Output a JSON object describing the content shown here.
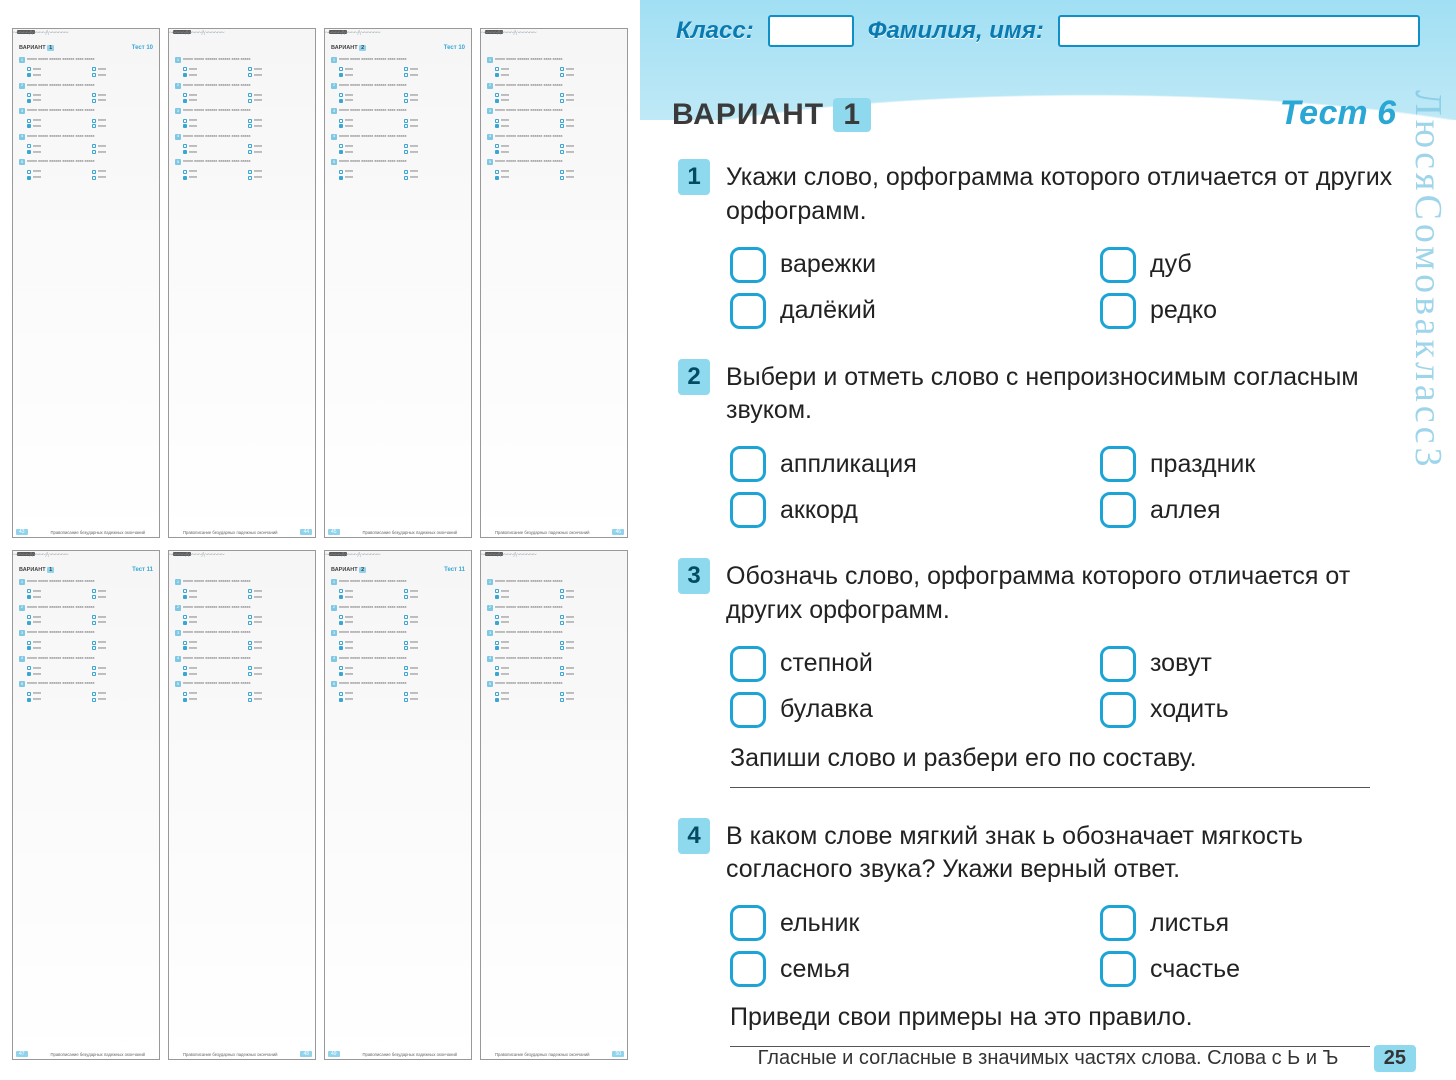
{
  "thumbs": [
    {
      "variant": "ВАРИАНТ 1",
      "test": "Тест 10",
      "page": "43",
      "side": "l"
    },
    {
      "variant": "",
      "test": "",
      "page": "44",
      "side": "r"
    },
    {
      "variant": "ВАРИАНТ 2",
      "test": "Тест 10",
      "page": "45",
      "side": "l"
    },
    {
      "variant": "",
      "test": "",
      "page": "46",
      "side": "r"
    },
    {
      "variant": "ВАРИАНТ 1",
      "test": "Тест 11",
      "page": "47",
      "side": "l"
    },
    {
      "variant": "",
      "test": "",
      "page": "48",
      "side": "r"
    },
    {
      "variant": "ВАРИАНТ 2",
      "test": "Тест 11",
      "page": "49",
      "side": "l"
    },
    {
      "variant": "",
      "test": "",
      "page": "50",
      "side": "r"
    }
  ],
  "thumb_footer": "Правописание безударных падежных окончаний",
  "header": {
    "class_label": "Класс:",
    "name_label": "Фамилия, имя:"
  },
  "title": {
    "variant": "ВАРИАНТ",
    "variant_num": "1",
    "test": "Тест 6"
  },
  "questions": [
    {
      "num": "1",
      "text": "Укажи слово, орфограмма которого отличается от других орфограмм.",
      "options": [
        "варежки",
        "дуб",
        "далёкий",
        "редко"
      ]
    },
    {
      "num": "2",
      "text": "Выбери и отметь слово с непроизносимым соглас­ным звуком.",
      "options": [
        "аппликация",
        "праздник",
        "аккорд",
        "аллея"
      ]
    },
    {
      "num": "3",
      "text": "Обозначь слово, орфограмма которого отличается от других орфограмм.",
      "options": [
        "степной",
        "зовут",
        "булавка",
        "ходить"
      ],
      "follow": "Запиши слово и разбери его по составу."
    },
    {
      "num": "4",
      "text": "В каком слове мягкий знак ь обозначает мягкость согласного звука? Укажи верный ответ.",
      "options": [
        "ельник",
        "листья",
        "семья",
        "счастье"
      ],
      "follow": "Приведи свои примеры на это правило."
    }
  ],
  "footer": {
    "text": "Гласные и согласные в значимых частях слова. Слова с Ь и Ъ",
    "page": "25"
  },
  "doodle": "ЛюсяСомовакласс3"
}
